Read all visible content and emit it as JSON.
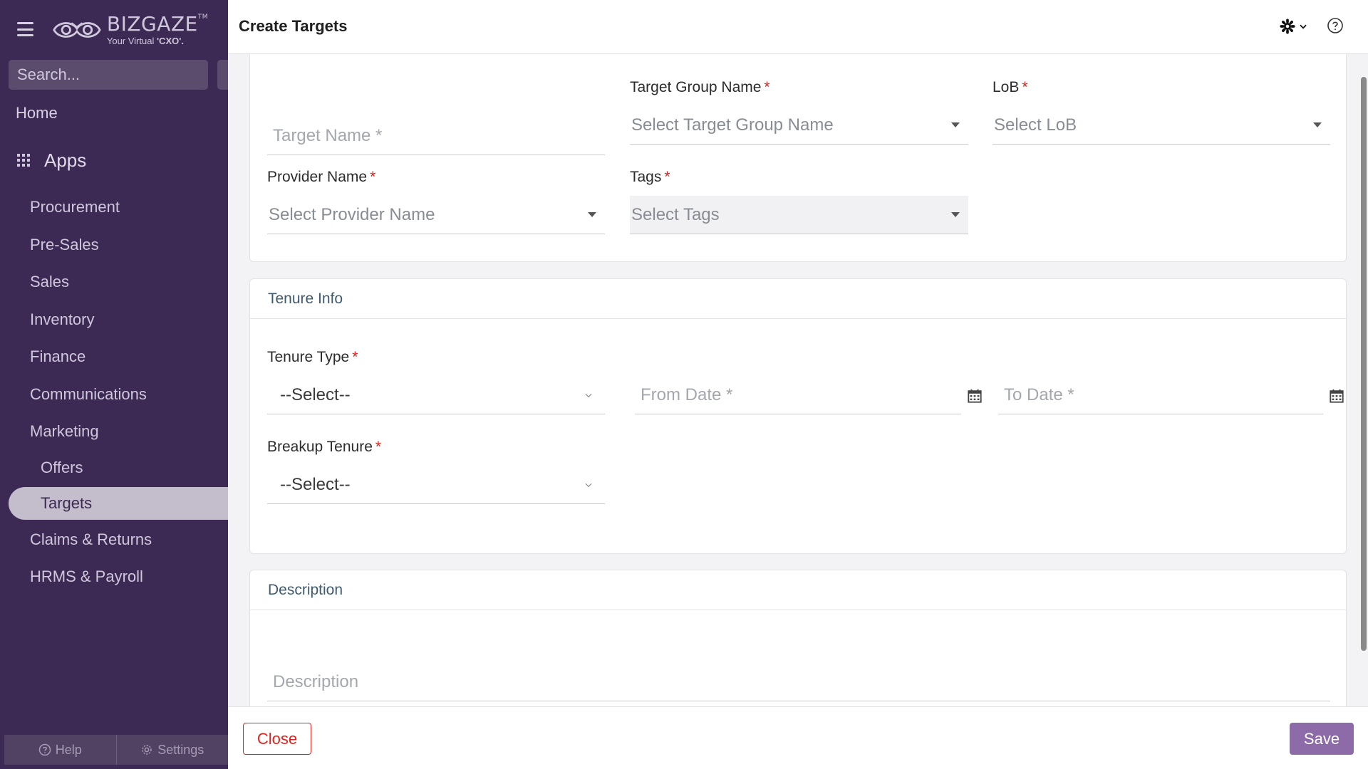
{
  "brand": {
    "name": "BIZGAZE",
    "trademark": "TM",
    "tagline_prefix": "Your Virtual ",
    "tagline_bold": "'CXO'."
  },
  "sidebar": {
    "search_placeholder": "Search...",
    "home": "Home",
    "apps": "Apps",
    "items": [
      {
        "label": "Procurement"
      },
      {
        "label": "Pre-Sales"
      },
      {
        "label": "Sales"
      },
      {
        "label": "Inventory"
      },
      {
        "label": "Finance"
      },
      {
        "label": "Communications"
      },
      {
        "label": "Marketing"
      }
    ],
    "sub_items": [
      {
        "label": "Offers"
      },
      {
        "label": "Targets",
        "active": true
      }
    ],
    "items_after": [
      {
        "label": "Claims & Returns"
      },
      {
        "label": "HRMS & Payroll"
      }
    ],
    "help": "Help",
    "settings": "Settings"
  },
  "header": {
    "title": "Create Targets"
  },
  "form": {
    "target_name_placeholder": "Target Name *",
    "target_group": {
      "label": "Target Group Name",
      "placeholder": "Select Target Group Name"
    },
    "lob": {
      "label": "LoB",
      "placeholder": "Select LoB"
    },
    "provider": {
      "label": "Provider Name",
      "placeholder": "Select Provider Name"
    },
    "tags": {
      "label": "Tags",
      "placeholder": "Select Tags"
    },
    "required_mark": "*"
  },
  "tenure": {
    "section_title": "Tenure Info",
    "tenure_type": {
      "label": "Tenure Type",
      "value": "--Select--"
    },
    "from_date_placeholder": "From Date *",
    "to_date_placeholder": "To Date *",
    "breakup_tenure": {
      "label": "Breakup Tenure",
      "value": "--Select--"
    }
  },
  "description": {
    "section_title": "Description",
    "placeholder": "Description"
  },
  "footer": {
    "close_label": "Close",
    "save_label": "Save"
  },
  "colors": {
    "sidebar_bg": "#3c2a55",
    "accent": "#8d6aa8",
    "required": "#e0221c",
    "close_border": "#e0221c"
  }
}
